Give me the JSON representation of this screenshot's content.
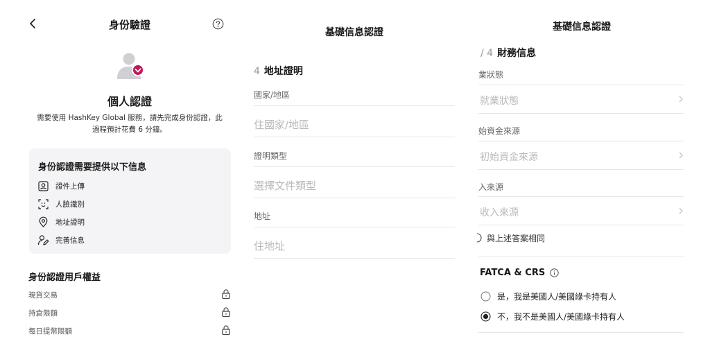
{
  "identity": {
    "title": "身份驗證",
    "heading": "個人認證",
    "description": "需要使用 HashKey Global 服務，請先完成身份認證，此過程預計花費 6 分鐘。",
    "card": {
      "title": "身份認證需要提供以下信息",
      "items": [
        {
          "label": "證件上傳",
          "icon": "id-card-icon"
        },
        {
          "label": "人臉識別",
          "icon": "face-scan-icon"
        },
        {
          "label": "地址證明",
          "icon": "location-pin-icon"
        },
        {
          "label": "完善信息",
          "icon": "user-edit-icon"
        }
      ]
    },
    "permissions": {
      "title": "身份認證用戶權益",
      "items": [
        {
          "label": "現貨交易"
        },
        {
          "label": "持倉限額"
        },
        {
          "label": "每日提幣限額"
        }
      ]
    }
  },
  "address": {
    "title": "基礎信息認證",
    "step_num": "4",
    "section": "地址證明",
    "country_label": "國家/地區",
    "country_placeholder": "住國家/地區",
    "doc_type_label": "證明類型",
    "doc_type_placeholder": "選擇文件類型",
    "address_label": "地址",
    "address_placeholder": "住地址"
  },
  "finance": {
    "title": "基礎信息認證",
    "step_num": "/ 4",
    "section": "財務信息",
    "employment_label": "業狀態",
    "employment_placeholder": "就業狀態",
    "funds_label": "始資金來源",
    "funds_placeholder": "初始資金來源",
    "income_label": "入來源",
    "income_placeholder": "收入來源",
    "same_as_above": "與上述答案相同",
    "fatca_title": "FATCA & CRS",
    "option_yes": "是，我是美國人/美國綠卡持有人",
    "option_no": "不，我不是美國人/美國綠卡持有人"
  },
  "colors": {
    "accent": "#c2185b",
    "card_bg": "#f4f4f6",
    "placeholder": "#b8b8b8",
    "divider": "#e6e6e6"
  }
}
